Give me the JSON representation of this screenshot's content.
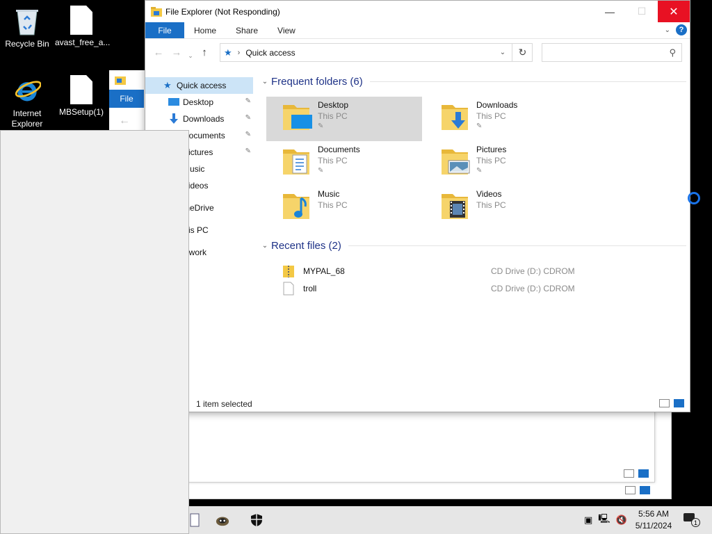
{
  "desktop": {
    "icons": [
      {
        "label": "Recycle Bin"
      },
      {
        "label": "avast_free_a..."
      },
      {
        "label": "Internet Explorer"
      },
      {
        "label": "MBSetup(1)"
      }
    ]
  },
  "window": {
    "title": "File Explorer (Not Responding)",
    "controls": {
      "minimize": "—",
      "maximize": "☐",
      "close": "✕"
    }
  },
  "mid_window": {
    "file_tab": "File"
  },
  "ribbon": {
    "tabs": [
      "File",
      "Home",
      "Share",
      "View"
    ],
    "help": "?"
  },
  "address": {
    "back": "←",
    "forward": "→",
    "recent": "⌄",
    "up": "↑",
    "path": "Quick access",
    "separator": "›",
    "refresh": "↻",
    "search_placeholder": ""
  },
  "nav": {
    "items": [
      {
        "label": "Quick access",
        "selected": true,
        "icon": "star-icon"
      },
      {
        "label": "Desktop",
        "pinned": true,
        "icon": "desktop-icon"
      },
      {
        "label": "Downloads",
        "pinned": true,
        "icon": "downloads-icon"
      },
      {
        "label": "Documents",
        "pinned": true,
        "icon": "documents-icon"
      },
      {
        "label": "Pictures",
        "pinned": true,
        "icon": "pictures-icon"
      },
      {
        "label": "Music",
        "icon": "music-icon"
      },
      {
        "label": "Videos",
        "icon": "videos-icon"
      },
      {
        "label": "OneDrive",
        "icon": "cloud-icon"
      },
      {
        "label": "This PC",
        "icon": "computer-icon"
      },
      {
        "label": "Network",
        "icon": "network-icon"
      }
    ],
    "pin_glyph": "📌"
  },
  "frequent": {
    "heading": "Frequent folders (6)",
    "folders": [
      {
        "name": "Desktop",
        "location": "This PC",
        "selected": true
      },
      {
        "name": "Downloads",
        "location": "This PC"
      },
      {
        "name": "Documents",
        "location": "This PC"
      },
      {
        "name": "Pictures",
        "location": "This PC"
      },
      {
        "name": "Music",
        "location": "This PC"
      },
      {
        "name": "Videos",
        "location": "This PC"
      }
    ]
  },
  "recent": {
    "heading": "Recent files (2)",
    "files": [
      {
        "name": "MYPAL_68",
        "location": "CD Drive (D:) CDROM"
      },
      {
        "name": "troll",
        "location": "CD Drive (D:) CDROM"
      }
    ]
  },
  "status": {
    "text": "1 item selected"
  },
  "taskbar": {
    "time": "5:56 AM",
    "date": "5/11/2024",
    "notification_count": "1"
  },
  "colors": {
    "accent": "#1a6fc6",
    "close": "#e81123",
    "selection": "#cce4f7",
    "heading": "#1e3287"
  }
}
